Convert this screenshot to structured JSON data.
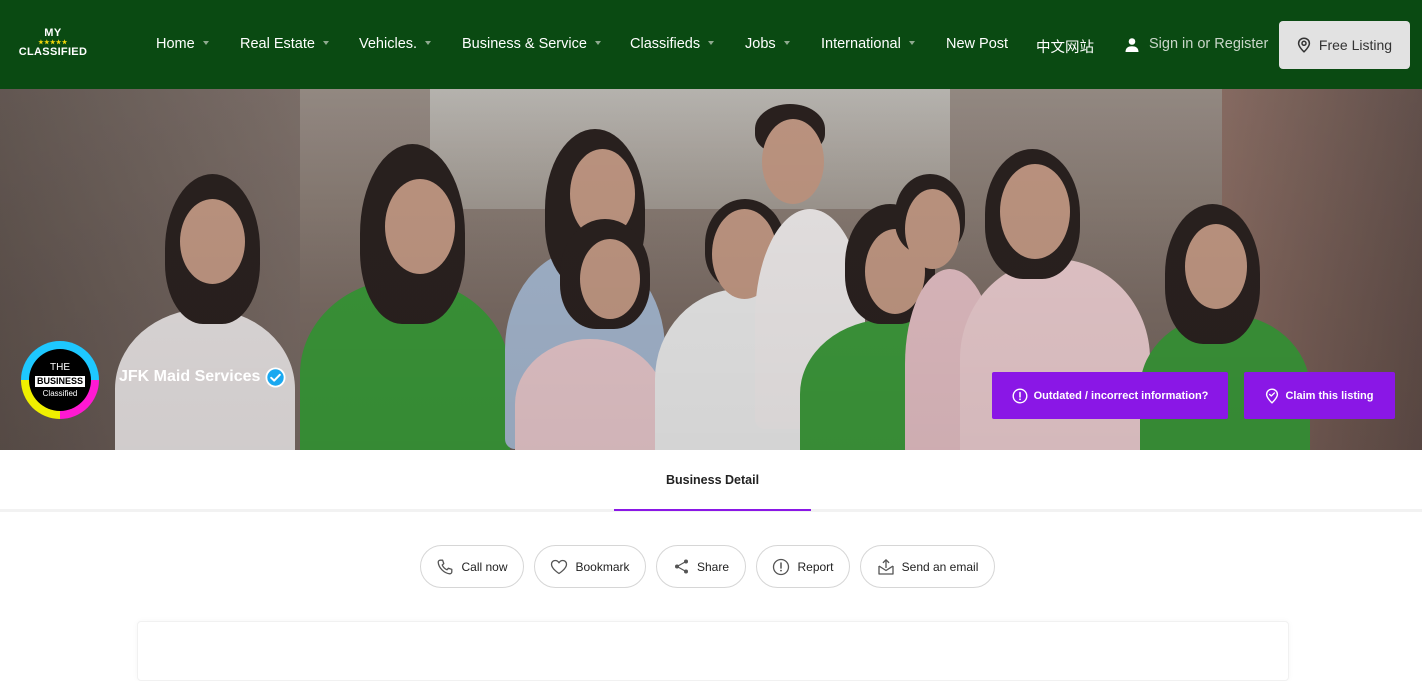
{
  "brand": {
    "line1": "MY",
    "stars": "★★★★★",
    "line2": "CLASSIFIED"
  },
  "nav": {
    "items": [
      {
        "label": "Home",
        "has_dropdown": true
      },
      {
        "label": "Real Estate",
        "has_dropdown": true
      },
      {
        "label": "Vehicles.",
        "has_dropdown": true
      },
      {
        "label": "Business & Service",
        "has_dropdown": true
      },
      {
        "label": "Classifieds",
        "has_dropdown": true
      },
      {
        "label": "Jobs",
        "has_dropdown": true
      },
      {
        "label": "International",
        "has_dropdown": true
      },
      {
        "label": "New Post",
        "has_dropdown": false
      },
      {
        "label": "中文网站",
        "has_dropdown": false
      }
    ],
    "signin_label": "Sign in or Register",
    "free_listing_label": "Free Listing"
  },
  "hero": {
    "logo_text": {
      "line1": "THE",
      "line2": "BUSINESS",
      "line3": "Classified"
    },
    "business_name": "JFK Maid Services",
    "verified": true,
    "outdated_label": "Outdated / incorrect information?",
    "claim_label": "Claim this listing"
  },
  "tabs": [
    {
      "label": "Business Detail",
      "active": true
    }
  ],
  "actions": {
    "call": "Call now",
    "bookmark": "Bookmark",
    "share": "Share",
    "report": "Report",
    "email": "Send an email"
  },
  "colors": {
    "nav_bg": "#0a4a12",
    "accent_purple": "#8a17e6",
    "verified_blue": "#1aa8f0"
  }
}
